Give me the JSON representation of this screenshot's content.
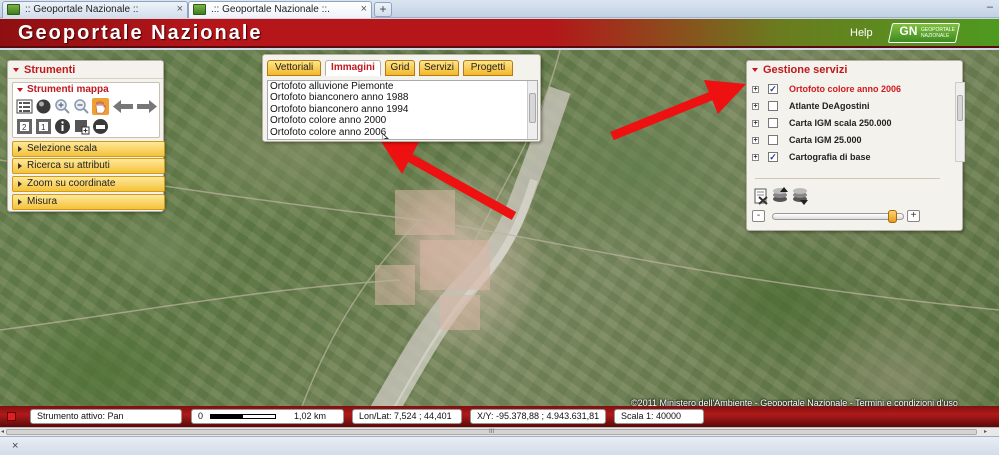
{
  "browser": {
    "tabs": [
      {
        "label": ":: Geoportale Nazionale ::",
        "active": false
      },
      {
        "label": ".:: Geoportale Nazionale ::.",
        "active": true
      }
    ],
    "new_tab": "+",
    "tab_close": "×",
    "tab_menu": "–",
    "scroll_mid": "III",
    "scroll_left": "◂",
    "scroll_right": "▸",
    "findbar_close": "×"
  },
  "header": {
    "title": "Geoportale Nazionale",
    "help": "Help",
    "logo_mark": "GN",
    "logo_text": "GEOPORTALE NAZIONALE",
    "color_start": "#8e0f12",
    "color_end": "#4e9a1f"
  },
  "strumenti": {
    "title": "Strumenti",
    "map_tools_title": "Strumenti mappa",
    "accordion": [
      "Selezione scala",
      "Ricerca su attributi",
      "Zoom su coordinate",
      "Misura"
    ]
  },
  "images_panel": {
    "tabs": [
      {
        "label": "Vettoriali",
        "active": false
      },
      {
        "label": "Immagini",
        "active": true
      },
      {
        "label": "Grid",
        "active": false
      },
      {
        "label": "Servizi",
        "active": false
      },
      {
        "label": "Progetti",
        "active": false
      }
    ],
    "items": [
      "Ortofoto alluvione Piemonte",
      "Ortofoto bianconero anno 1988",
      "Ortofoto bianconero anno 1994",
      "Ortofoto colore anno 2000",
      "Ortofoto colore anno 2006"
    ]
  },
  "servizi": {
    "title": "Gestione servizi",
    "expander": "+",
    "check_mark": "✓",
    "opacity_minus": "-",
    "opacity_plus": "+",
    "opacity_level": 0.95,
    "layers": [
      {
        "label": "Ortofoto colore anno 2006",
        "checked": true,
        "active": true
      },
      {
        "label": "Atlante DeAgostini",
        "checked": false,
        "active": false
      },
      {
        "label": "Carta IGM scala 250.000",
        "checked": false,
        "active": false
      },
      {
        "label": "Carta IGM 25.000",
        "checked": false,
        "active": false
      },
      {
        "label": "Cartografia di base",
        "checked": true,
        "active": false
      }
    ]
  },
  "map": {
    "copyright": "©2011 Ministero dell'Ambiente - Geoportale Nazionale - Termini e condizioni d'uso",
    "annotation_color": "#ee1111"
  },
  "status": {
    "active_tool": "Strumento attivo: Pan",
    "scale_zero": "0",
    "scale_value": "1,02 km",
    "lonlat": "Lon/Lat: 7,524 ; 44,401",
    "xy": "X/Y: -95.378,88 ; 4.943.631,81",
    "scale": "Scala 1: 40000"
  }
}
